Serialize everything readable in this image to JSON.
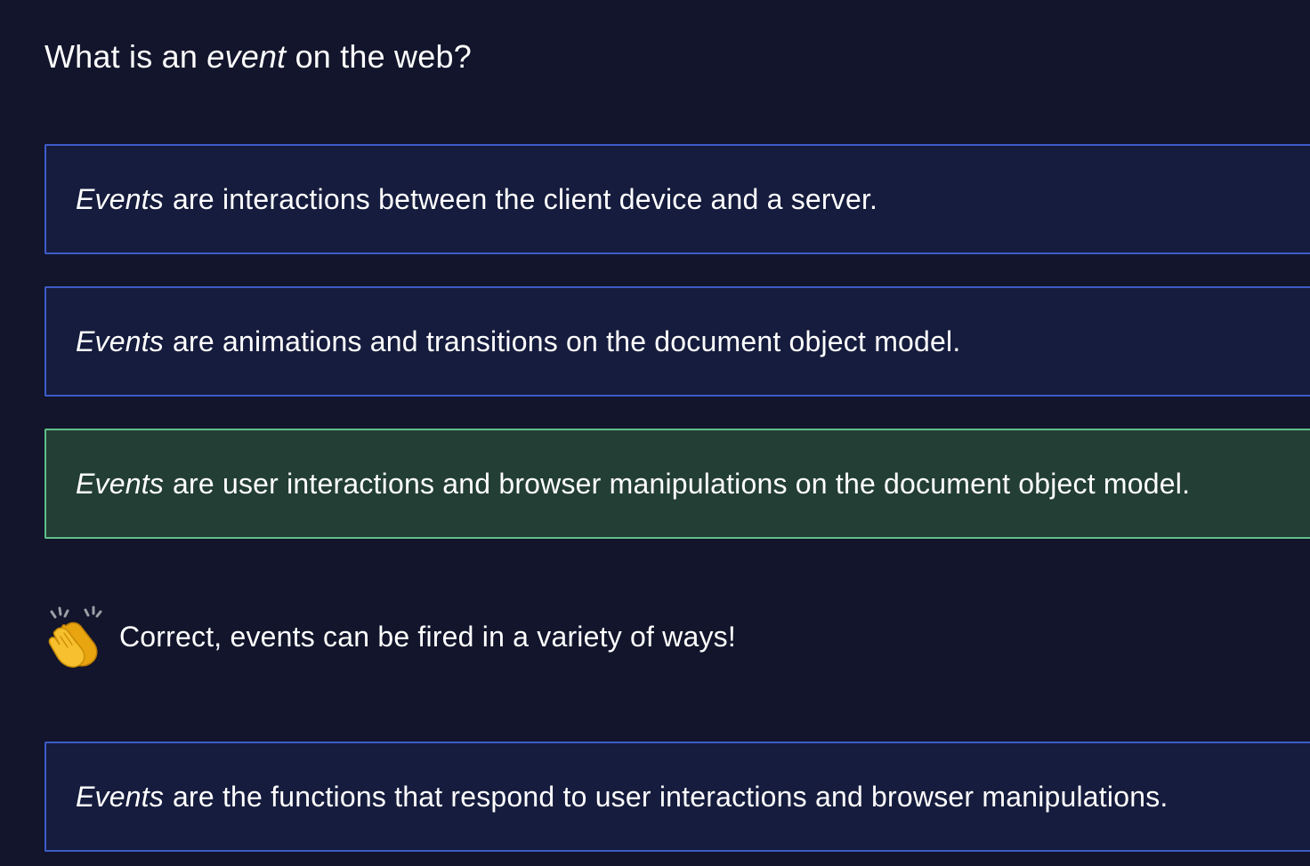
{
  "question": {
    "prefix": "What is an",
    "emphasis": "event",
    "suffix": "on the web?"
  },
  "options": [
    {
      "lead": "Events",
      "text": "are interactions between the client device and a server.",
      "state": "default"
    },
    {
      "lead": "Events",
      "text": "are animations and transitions on the document object model.",
      "state": "default"
    },
    {
      "lead": "Events",
      "text": "are user interactions and browser manipulations on the document object model.",
      "state": "correct"
    },
    {
      "lead": "Events",
      "text": "are the functions that respond to user interactions and browser manipulations.",
      "state": "default"
    }
  ],
  "feedback": {
    "icon": "clapping-hands-icon",
    "text": "Correct, events can be fired in a variety of ways!"
  },
  "colors": {
    "background": "#12152b",
    "option_background": "#161c3d",
    "option_border": "#3d5cc9",
    "correct_background": "#233e34",
    "correct_border": "#5fbf8a",
    "text": "#ffffff"
  }
}
